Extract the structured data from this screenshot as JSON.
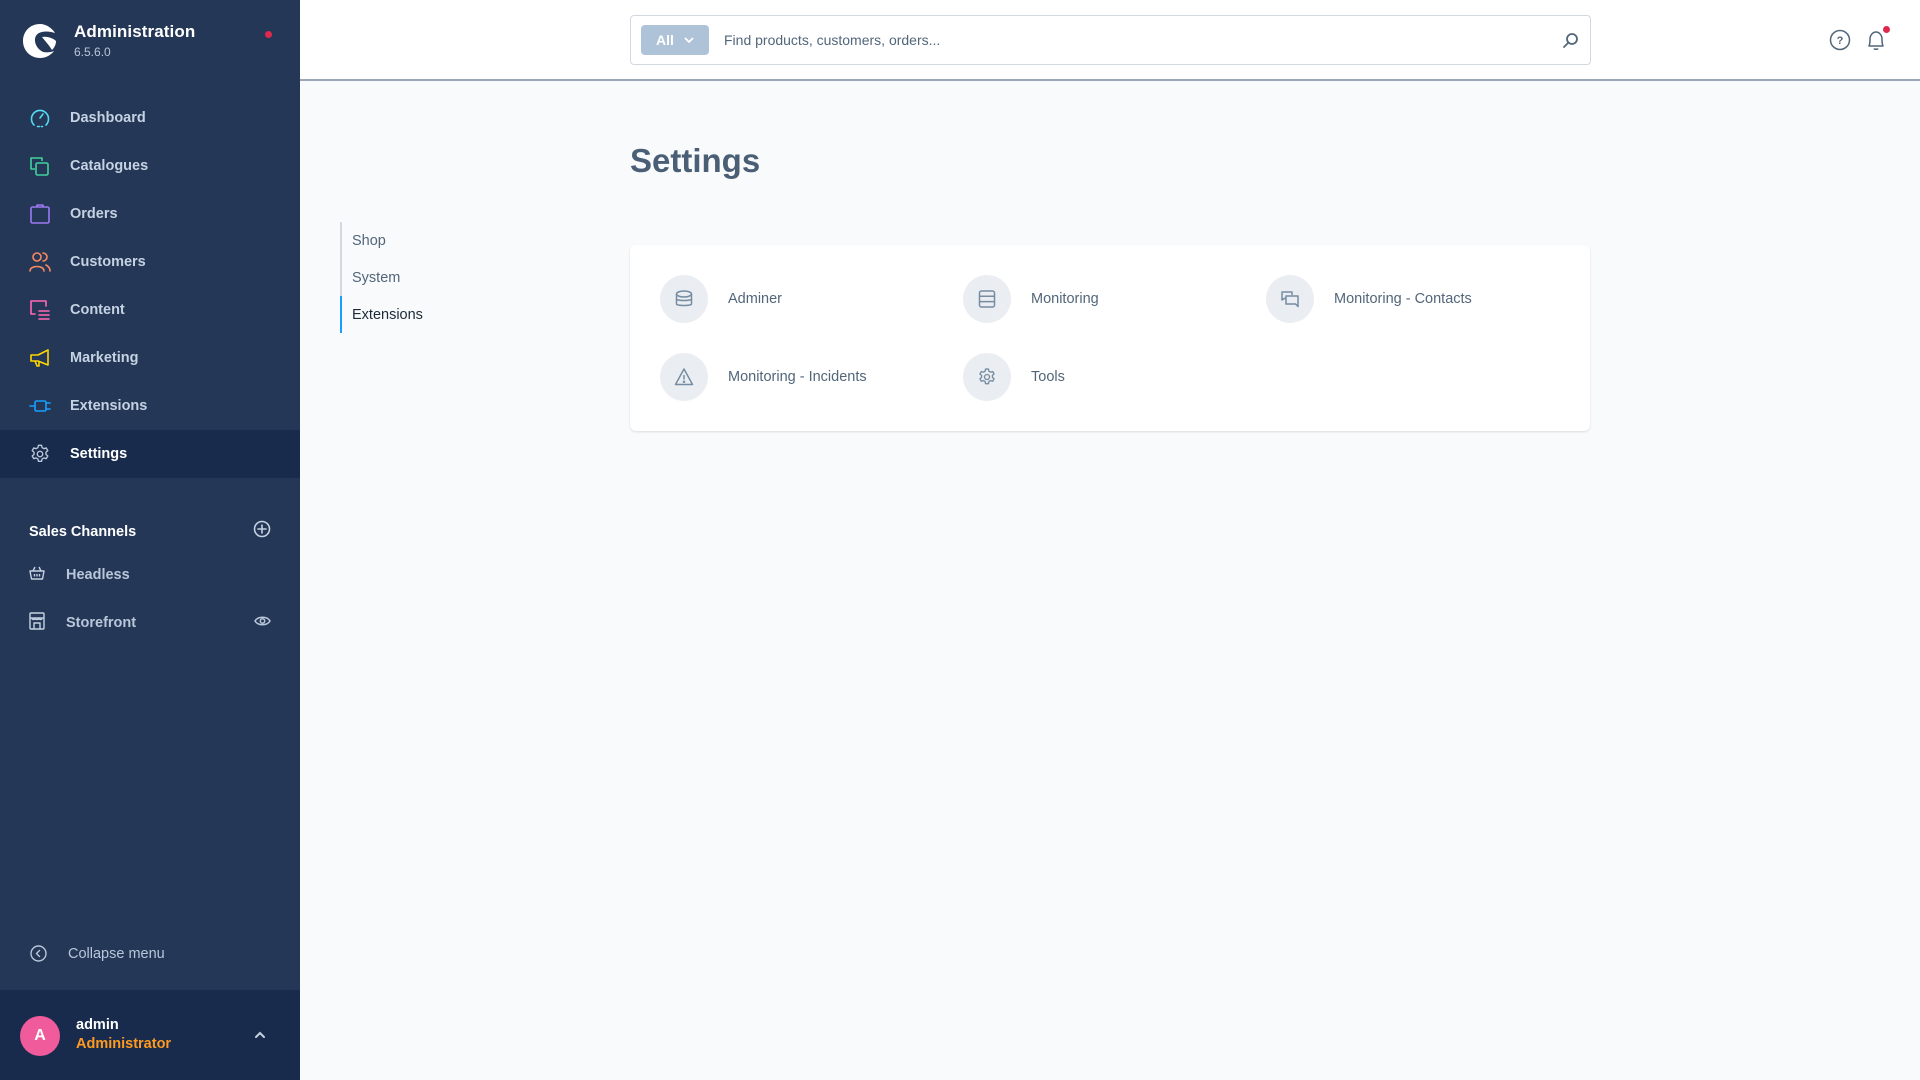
{
  "app": {
    "title": "Administration",
    "version": "6.5.6.0"
  },
  "sidebar": {
    "items": [
      {
        "label": "Dashboard",
        "icon": "dashboard-icon",
        "color": "#57d9f3"
      },
      {
        "label": "Catalogues",
        "icon": "catalogues-icon",
        "color": "#3fd39b"
      },
      {
        "label": "Orders",
        "icon": "orders-icon",
        "color": "#9d79f1"
      },
      {
        "label": "Customers",
        "icon": "customers-icon",
        "color": "#f88962"
      },
      {
        "label": "Content",
        "icon": "content-icon",
        "color": "#ff68b4"
      },
      {
        "label": "Marketing",
        "icon": "marketing-icon",
        "color": "#ffd700"
      },
      {
        "label": "Extensions",
        "icon": "extensions-icon",
        "color": "#189eff"
      },
      {
        "label": "Settings",
        "icon": "settings-icon",
        "color": "#b8c7d9",
        "active": true
      }
    ],
    "sales_channels": {
      "title": "Sales Channels",
      "items": [
        {
          "label": "Headless",
          "icon": "basket-icon"
        },
        {
          "label": "Storefront",
          "icon": "storefront-icon",
          "action_icon": "eye-icon"
        }
      ]
    },
    "collapse_label": "Collapse menu",
    "user": {
      "initial": "A",
      "name": "admin",
      "role": "Administrator"
    }
  },
  "header": {
    "search": {
      "type_label": "All",
      "placeholder": "Find products, customers, orders..."
    }
  },
  "main": {
    "title": "Settings",
    "tabs": [
      {
        "label": "Shop"
      },
      {
        "label": "System"
      },
      {
        "label": "Extensions",
        "active": true
      }
    ],
    "items": [
      {
        "label": "Adminer",
        "icon": "database-icon"
      },
      {
        "label": "Monitoring",
        "icon": "server-icon"
      },
      {
        "label": "Monitoring - Contacts",
        "icon": "chat-bubbles-icon"
      },
      {
        "label": "Monitoring - Incidents",
        "icon": "warning-icon"
      },
      {
        "label": "Tools",
        "icon": "gear-icon"
      }
    ]
  }
}
